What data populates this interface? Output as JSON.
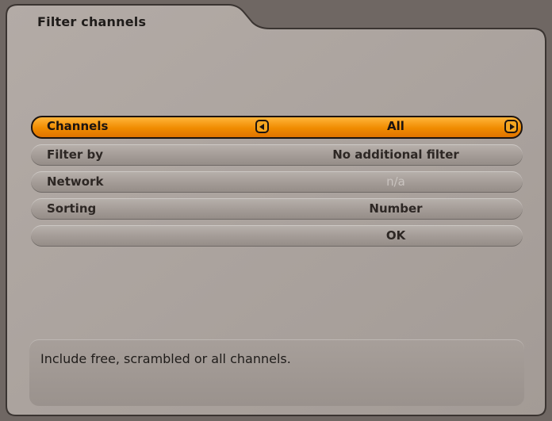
{
  "dialog": {
    "title": "Filter channels"
  },
  "menu": {
    "items": [
      {
        "label": "Channels",
        "value": "All"
      },
      {
        "label": "Filter by",
        "value": "No additional filter"
      },
      {
        "label": "Network",
        "value": "n/a"
      },
      {
        "label": "Sorting",
        "value": "Number"
      },
      {
        "label": "",
        "value": "OK"
      }
    ]
  },
  "help": {
    "text": "Include free, scrambled or all channels."
  },
  "colors": {
    "highlight": "#f08b00",
    "panel": "#aaa29d",
    "background": "#6f6763"
  }
}
